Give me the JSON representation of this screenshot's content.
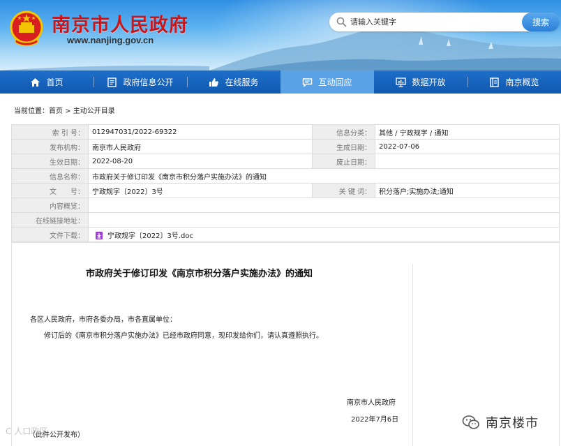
{
  "header": {
    "site_title": "南京市人民政府",
    "site_url": "www.nanjing.gov.cn",
    "search_placeholder": "请输入关键字",
    "search_button": "搜索"
  },
  "nav": {
    "items": [
      {
        "label": "首页",
        "icon": "home-icon"
      },
      {
        "label": "政府信息公开",
        "icon": "document-icon"
      },
      {
        "label": "在线服务",
        "icon": "thumbs-up-icon"
      },
      {
        "label": "互动回应",
        "icon": "chat-icon",
        "active": true
      },
      {
        "label": "数据开放",
        "icon": "monitor-chart-icon"
      },
      {
        "label": "南京概览",
        "icon": "book-icon"
      }
    ],
    "active_color": "#5aa2e6",
    "bar_color": "#1a66c0"
  },
  "breadcrumb": {
    "prefix": "当前位置：",
    "items": [
      "首页",
      "主动公开目录"
    ],
    "separator": " > "
  },
  "meta": {
    "index_label": "索 引 号：",
    "index_value": "012947031/2022-69322",
    "category_label": "信息分类：",
    "category_value": "其他 / 宁政规字 / 通知",
    "publisher_label": "发布机构：",
    "publisher_value": "南京市人民政府",
    "created_label": "生成日期：",
    "created_value": "2022-07-06",
    "effective_label": "生效日期：",
    "effective_value": "2022-08-20",
    "expiry_label": "废止日期：",
    "expiry_value": "",
    "name_label": "信息名称：",
    "name_value": "市政府关于修订印发《南京市积分落户实施办法》的通知",
    "docno_label": "文　　号：",
    "docno_value": "宁政规字〔2022〕3号",
    "keywords_label": "关 键 词：",
    "keywords_value": "积分落户;实施办法;通知",
    "summary_label": "内容概览：",
    "summary_value": "",
    "link_label": "在线链接地址：",
    "link_value": "",
    "download_label": "文件下载：",
    "download_value": "宁政规字〔2022〕3号.doc"
  },
  "article": {
    "title": "市政府关于修订印发《南京市积分落户实施办法》的通知",
    "salutation": "各区人民政府，市府各委办局，市各直属单位：",
    "body": "修订后的《南京市积分落户实施办法》已经市政府同意，现印发给你们，请认真遵照执行。",
    "sign_org": "南京市人民政府",
    "sign_date": "2022年7月6日",
    "note": "（此件公开发布）"
  },
  "watermarks": {
    "left": "C 人口政区",
    "right": "南京楼市"
  },
  "colors": {
    "title_red": "#c8161d",
    "label_gray": "#eeeeee"
  }
}
